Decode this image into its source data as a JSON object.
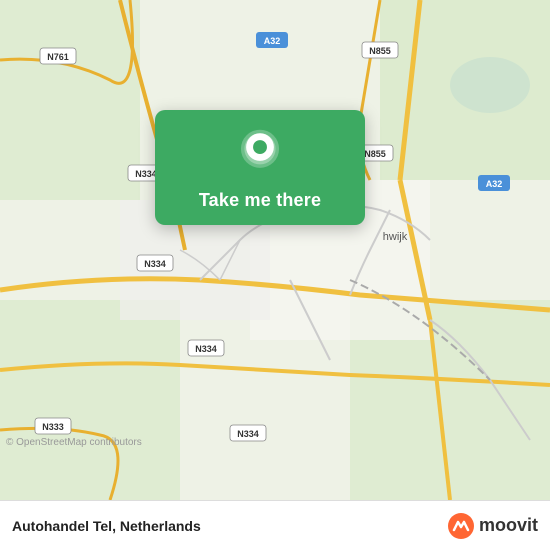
{
  "map": {
    "attribution": "© OpenStreetMap contributors",
    "background_color": "#e8f0e0"
  },
  "popup": {
    "button_label": "Take me there",
    "pin_color": "#ffffff"
  },
  "bottom_bar": {
    "location_name": "Autohandel Tel, Netherlands",
    "moovit_label": "moovit"
  }
}
